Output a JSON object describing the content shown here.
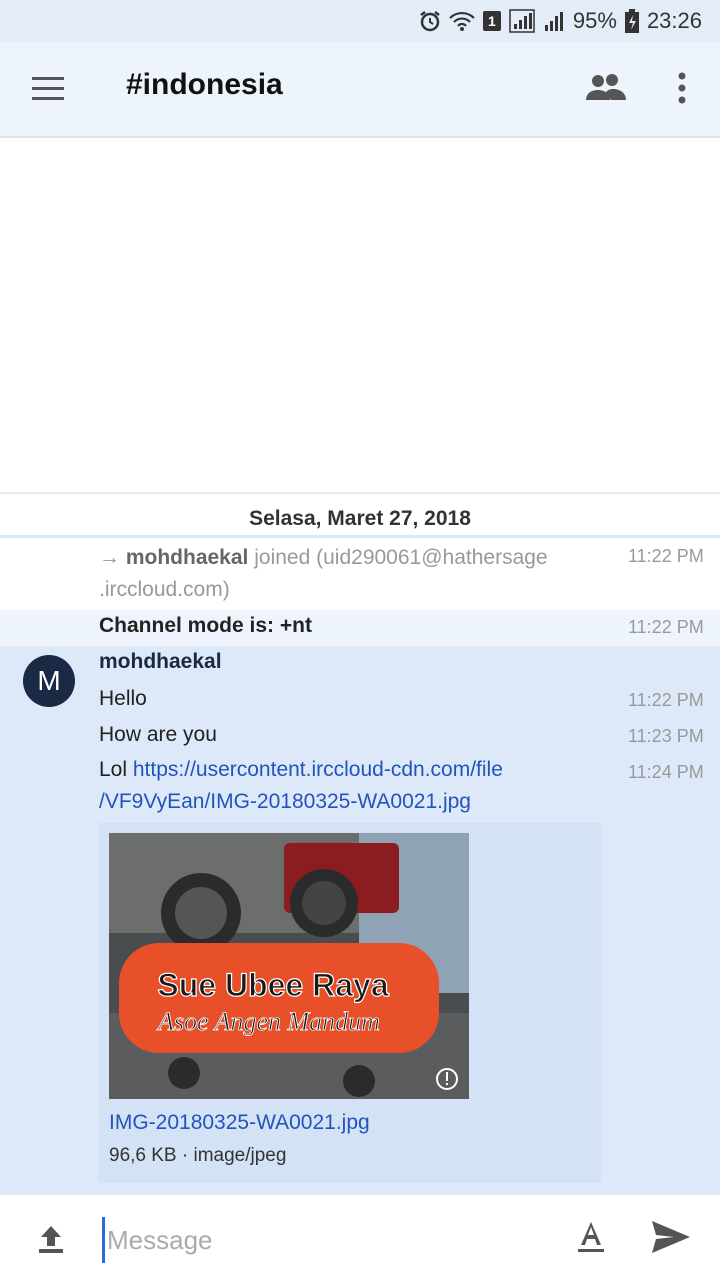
{
  "status_bar": {
    "battery": "95%",
    "time": "23:26",
    "sim_slot": "1",
    "icons": [
      "alarm-icon",
      "wifi-icon",
      "sim-1-badge",
      "signal-icon",
      "signal-icon",
      "battery-icon"
    ]
  },
  "header": {
    "channel": "#indonesia",
    "icons": [
      "menu-icon",
      "members-icon",
      "overflow-icon"
    ]
  },
  "date_divider": "Selasa, Maret 27, 2018",
  "events": {
    "join": {
      "arrow": "→",
      "nick": "mohdhaekal",
      "text_line1": "joined (uid290061@hathersage",
      "text_line2": ".irccloud.com)",
      "time": "11:22 PM"
    },
    "mode": {
      "text": "Channel mode is: +nt",
      "time": "11:22 PM"
    }
  },
  "messages": {
    "avatar_letter": "M",
    "nick": "mohdhaekal",
    "lines": [
      {
        "text": "Hello",
        "time": "11:22 PM"
      },
      {
        "text": "How are you",
        "time": "11:23 PM"
      },
      {
        "prefix": "Lol",
        "link_line1": "https://usercontent.irccloud-cdn.com/file",
        "link_line2": "/VF9VyEan/IMG-20180325-WA0021.jpg",
        "time": "11:24 PM"
      }
    ],
    "attachment": {
      "image_text1": "Sue Ubee Raya",
      "image_text2": "Asoe Angen Mandum",
      "file_name": "IMG-20180325-WA0021.jpg",
      "file_meta": "96,6 KB · image/jpeg"
    }
  },
  "composer": {
    "placeholder": "Message",
    "icons": [
      "upload-icon",
      "format-text-icon",
      "send-icon"
    ]
  },
  "colors": {
    "accent": "#2a6be0",
    "link": "#2255bb",
    "avatar_bg": "#1a2a44",
    "message_bg": "#dde8f8"
  }
}
